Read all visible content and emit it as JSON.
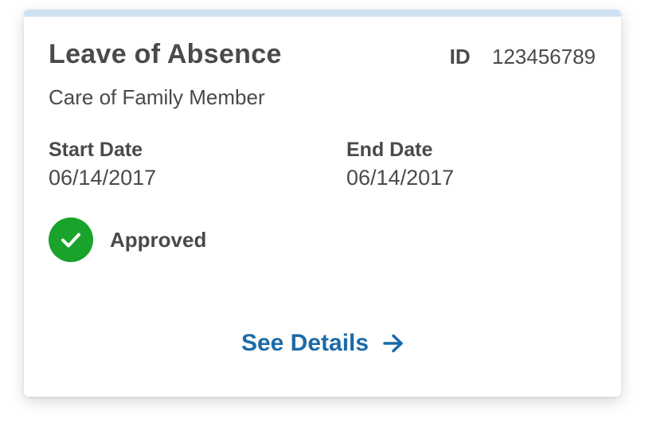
{
  "colors": {
    "top_bar": "#cfe2f3",
    "text": "#4a4a4a",
    "approved_green": "#1aa32a",
    "link_blue": "#1c6aa8"
  },
  "card": {
    "title": "Leave of Absence",
    "id_label": "ID",
    "id_value": "123456789",
    "subtitle": "Care of Family Member",
    "start_date_label": "Start Date",
    "start_date_value": "06/14/2017",
    "end_date_label": "End Date",
    "end_date_value": "06/14/2017",
    "status": {
      "icon": "check-circle-icon",
      "label": "Approved"
    },
    "details_link": {
      "label": "See Details",
      "icon": "arrow-right-icon"
    }
  }
}
